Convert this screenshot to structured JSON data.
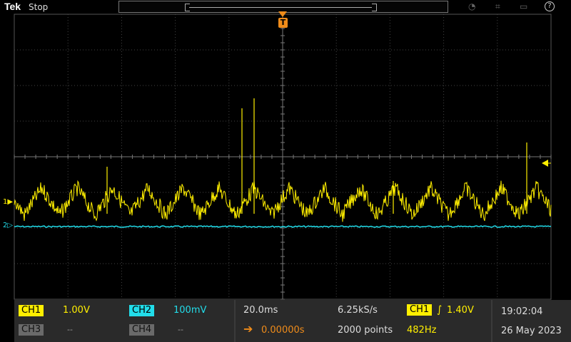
{
  "header": {
    "logo": "Tek",
    "run_state": "Stop",
    "icons": [
      "wifi-icon",
      "network-icon",
      "file-icon",
      "help-icon"
    ],
    "help_glyph": "?",
    "trigger_glyph": "T"
  },
  "markers": {
    "ch1": "1",
    "ch2": "2"
  },
  "channels": {
    "ch1": {
      "label": "CH1",
      "scale": "1.00V",
      "color": "#ffef00"
    },
    "ch2": {
      "label": "CH2",
      "scale": "100mV",
      "color": "#22ddea"
    },
    "ch3": {
      "label": "CH3",
      "scale": "--"
    },
    "ch4": {
      "label": "CH4",
      "scale": "--"
    }
  },
  "horizontal": {
    "timebase": "20.0ms",
    "delay": "0.00000s",
    "sample_rate": "6.25kS/s",
    "record_length": "2000 points"
  },
  "trigger": {
    "source": "CH1",
    "slope_glyph": "∫",
    "level": "1.40V",
    "frequency": "482Hz",
    "color": "#f08c1a"
  },
  "clock": {
    "time": "19:02:04",
    "date": "26 May 2023"
  }
}
